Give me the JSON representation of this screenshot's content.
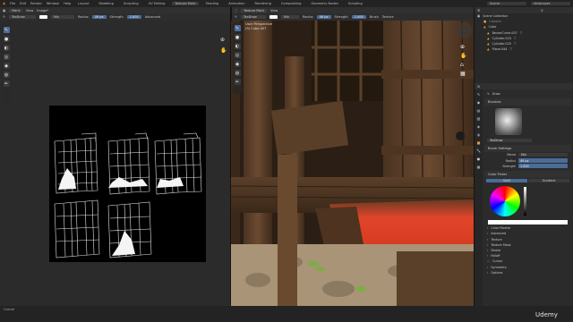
{
  "topbar": {
    "menus": [
      "File",
      "Edit",
      "Render",
      "Window",
      "Help"
    ],
    "workspaces": [
      "Layout",
      "Modeling",
      "Sculpting",
      "UV Editing",
      "Texture Paint",
      "Shading",
      "Animation",
      "Rendering",
      "Compositing",
      "Geometry Nodes",
      "Scripting"
    ],
    "active_workspace": "Texture Paint",
    "scene_label": "Scene",
    "viewlayer_label": "ViewLayer"
  },
  "image_editor": {
    "mode": "Paint",
    "view_menu": "View",
    "image_menu": "Image*",
    "brush_name": "TexDraw",
    "blend": "Mix",
    "radius_label": "Radius",
    "radius_value": "49 px",
    "strength_label": "Strength",
    "strength_value": "1.000",
    "advanced_label": "Advanced"
  },
  "viewport": {
    "header_mode": "Texture Paint",
    "view_menu": "View",
    "brush_name": "TexDraw",
    "blend": "Mix",
    "radius_label": "Radius",
    "radius_value": "49 px",
    "strength_label": "Strength",
    "strength_value": "1.000",
    "brush_menu": "Brush",
    "texture_menu": "Texture",
    "overlay_line1": "User Perspective",
    "overlay_line2": "(9) Cube.007"
  },
  "outliner": {
    "title": "Scene Collection",
    "items": [
      {
        "label": "Camera"
      },
      {
        "label": "Cube"
      },
      {
        "label": "BezierCurve.007"
      },
      {
        "label": "Cylinder.024"
      },
      {
        "label": "Cylinder.025"
      },
      {
        "label": "Plane.044"
      }
    ]
  },
  "properties": {
    "brush_tool": "Draw",
    "brushes_title": "Brushes",
    "brush_name": "TexDraw",
    "brush_settings_title": "Brush Settings",
    "blend_label": "Blend",
    "blend_value": "Mix",
    "radius_label": "Radius",
    "radius_value": "49 px",
    "strength_label": "Strength",
    "strength_value": "1.000",
    "color_picker_title": "Color Picker",
    "tab_solid": "Solid",
    "tab_gradient": "Gradient",
    "sections": [
      "Color Palette",
      "Advanced",
      "Texture",
      "Texture Mask",
      "Stroke",
      "Falloff",
      "Cursor",
      "Symmetry",
      "Options"
    ]
  },
  "statusbar": {
    "left_text": "Cancel",
    "watermark": "Udemy"
  }
}
